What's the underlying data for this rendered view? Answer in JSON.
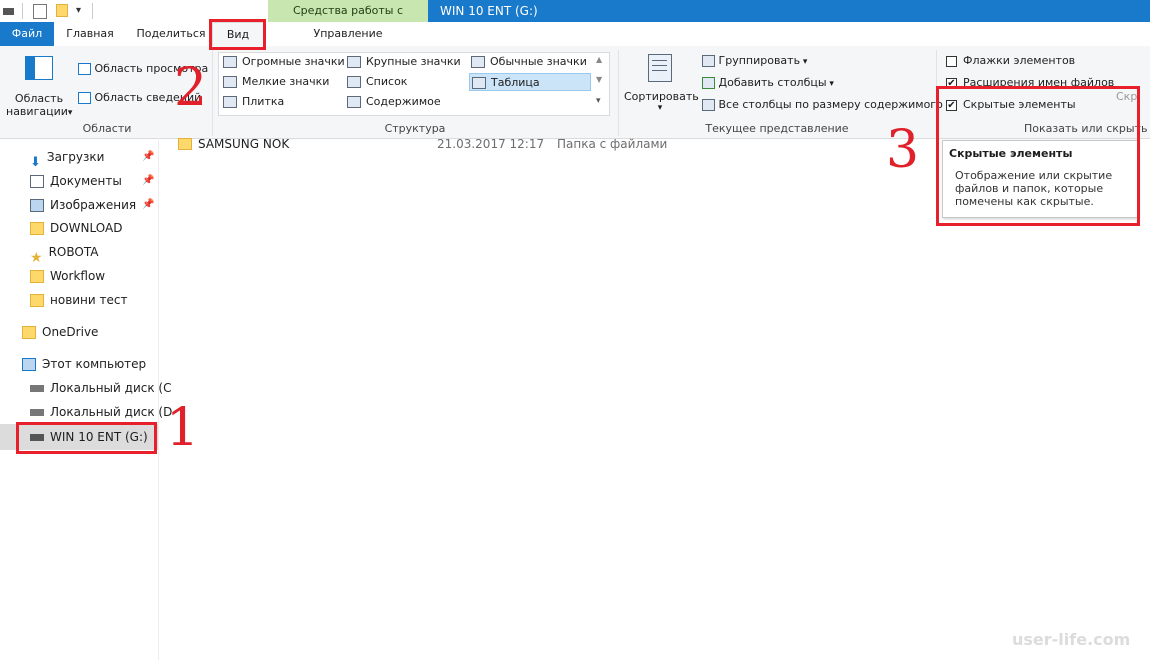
{
  "title_bar": {
    "context_tab_header": "Средства работы с дисками",
    "window_title": "WIN 10 ENT (G:)"
  },
  "tabs": {
    "file": "Файл",
    "home": "Главная",
    "share": "Поделиться",
    "view": "Вид",
    "manage": "Управление"
  },
  "ribbon": {
    "panes": {
      "nav_pane_line1": "Область",
      "nav_pane_line2": "навигации",
      "preview_pane": "Область просмотра",
      "details_pane": "Область сведений",
      "group_label": "Области"
    },
    "layout": {
      "items": [
        "Огромные значки",
        "Крупные значки",
        "Обычные значки",
        "Мелкие значки",
        "Список",
        "Таблица",
        "Плитка",
        "Содержимое"
      ],
      "selected": "Таблица",
      "group_label": "Структура"
    },
    "current_view": {
      "sort_by": "Сортировать",
      "group_by": "Группировать",
      "add_columns": "Добавить столбцы",
      "size_columns": "Все столбцы по размеру содержимого",
      "group_label": "Текущее представление"
    },
    "show_hide": {
      "item_checkboxes": {
        "label": "Флажки элементов",
        "checked": false
      },
      "file_extensions": {
        "label": "Расширения имен файлов",
        "checked": true
      },
      "hidden_items": {
        "label": "Скрытые элементы",
        "checked": true
      },
      "hide_selected_partial": "Скр",
      "group_label": "Показать или скрыть"
    }
  },
  "nav_pane": {
    "quick_access": [
      {
        "label": "Загрузки",
        "icon": "download-icon",
        "pinned": true
      },
      {
        "label": "Документы",
        "icon": "documents-icon",
        "pinned": true
      },
      {
        "label": "Изображения",
        "icon": "pictures-icon",
        "pinned": true
      },
      {
        "label": "DOWNLOAD",
        "icon": "folder-icon",
        "pinned": false
      },
      {
        "label": "ROBOTA",
        "icon": "star-icon",
        "pinned": false
      },
      {
        "label": "Workflow",
        "icon": "folder-icon",
        "pinned": false
      },
      {
        "label": "новини тест",
        "icon": "folder-icon",
        "pinned": false
      }
    ],
    "onedrive": "OneDrive",
    "this_pc": "Этот компьютер",
    "drives": [
      "Локальный диск (C",
      "Локальный диск (D",
      "WIN 10 ENT (G:)"
    ]
  },
  "file_list": {
    "rows": [
      {
        "name": "SAMSUNG NOK",
        "date": "21.03.2017 12:17",
        "type": "Папка с файлами"
      }
    ]
  },
  "tooltip": {
    "title": "Скрытые элементы",
    "body": "Отображение или скрытие файлов и папок, которые помечены как скрытые."
  },
  "annotations": {
    "one": "1",
    "two": "2",
    "three": "3"
  },
  "watermark": "user-life.com",
  "colors": {
    "accent": "#1979ca",
    "context_tab": "#c8e6b0",
    "annotation_red": "#e8202c"
  }
}
